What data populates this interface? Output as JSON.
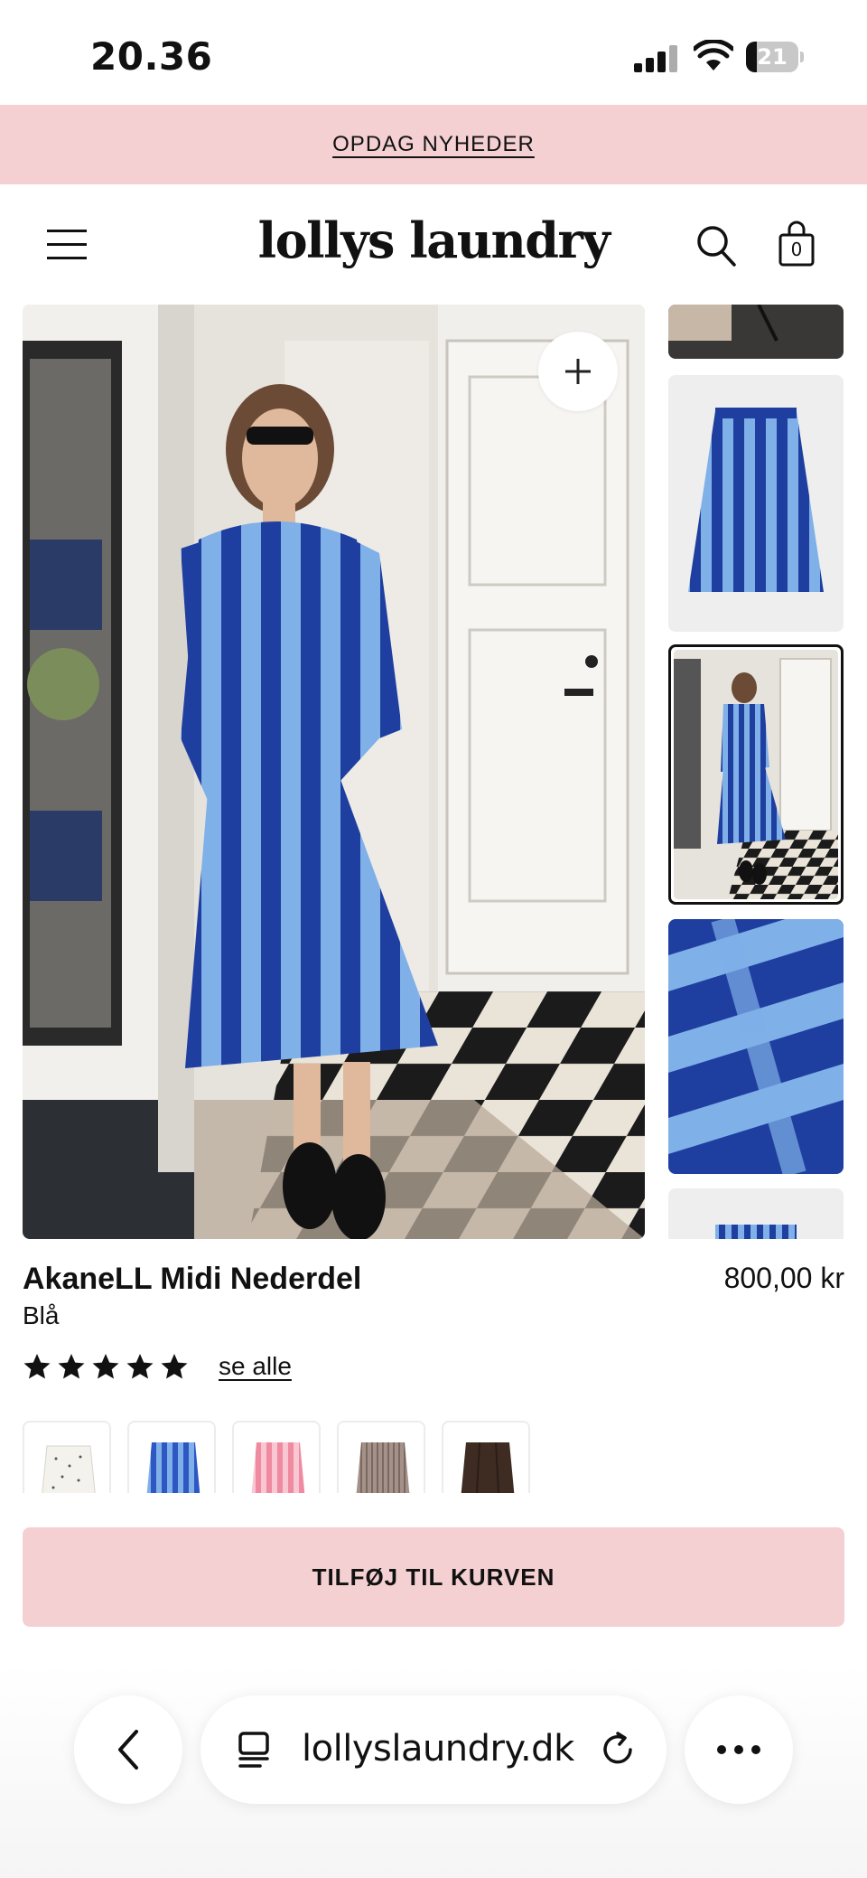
{
  "status_bar": {
    "time": "20.36",
    "battery_level": "21",
    "battery_fraction": 0.21
  },
  "promo": {
    "link_label": "OPDAG NYHEDER"
  },
  "header": {
    "logo_text": "lollys laundry",
    "cart_count": "0",
    "icons": [
      "menu-icon",
      "search-icon",
      "shopping-bag-icon"
    ]
  },
  "gallery": {
    "main_image_description_icon": "zoom-plus-icon",
    "thumbnails": [
      {
        "name": "thumb-shoes"
      },
      {
        "name": "thumb-skirt-packshot"
      },
      {
        "name": "thumb-model-doorway",
        "selected": true
      },
      {
        "name": "thumb-fabric-closeup"
      },
      {
        "name": "thumb-skirt-waistband"
      }
    ]
  },
  "product": {
    "title": "AkaneLL Midi Nederdel",
    "color": "Blå",
    "price": "800,00 kr",
    "rating_stars": 5,
    "see_all_label": "se alle"
  },
  "swatches": [
    {
      "name": "swatch-white-dots",
      "color": "#f3f2ec"
    },
    {
      "name": "swatch-blue-stripe",
      "color": "#2e57c4",
      "selected": true
    },
    {
      "name": "swatch-pink-stripe",
      "color": "#f08aa0"
    },
    {
      "name": "swatch-taupe",
      "color": "#8f7c72"
    },
    {
      "name": "swatch-dark-brown",
      "color": "#3e2c23"
    }
  ],
  "cta": {
    "add_to_cart_label": "TILFØJ TIL KURVEN"
  },
  "browser": {
    "url": "lollyslaundry.dk"
  },
  "colors": {
    "accent_pink": "#f4d0d2",
    "navy_stripe": "#1f3fa0",
    "light_stripe": "#7fb0e8"
  }
}
